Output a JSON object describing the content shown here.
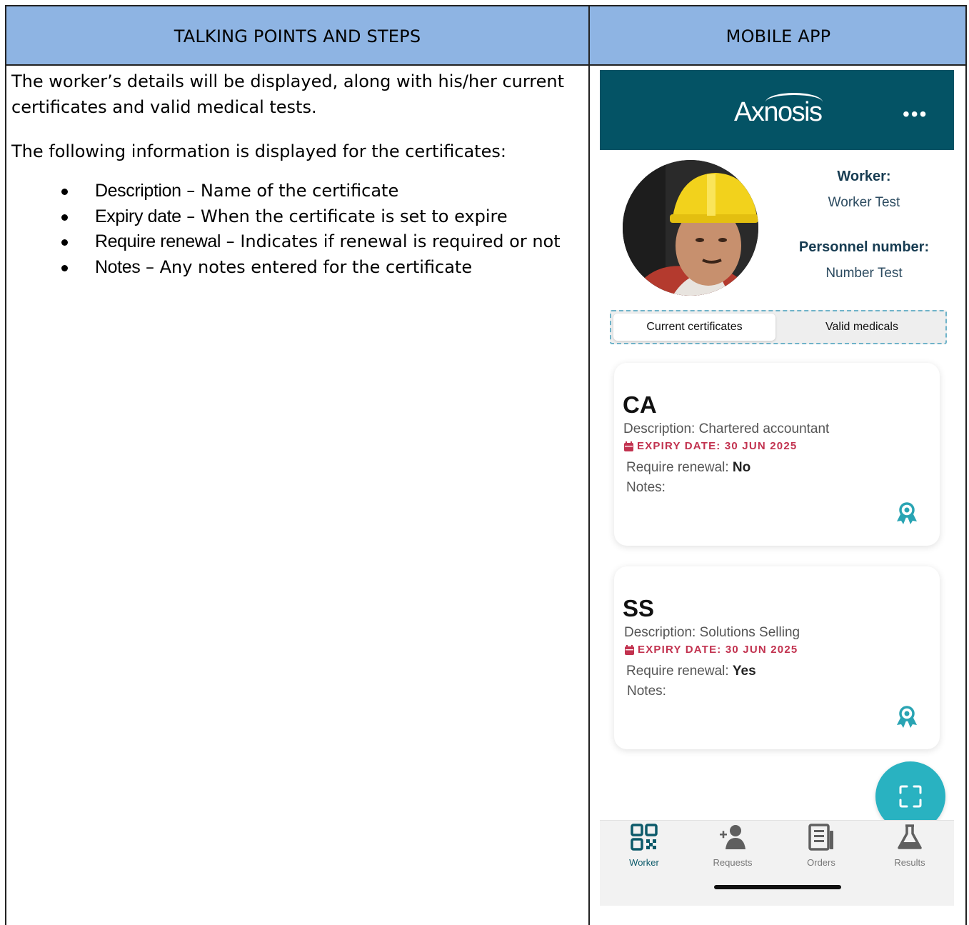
{
  "document": {
    "header_left": "TALKING POINTS AND STEPS",
    "header_right": "MOBILE APP",
    "paragraph1": "The worker’s details will be displayed, along with his/her current certificates and valid medical tests.",
    "paragraph2": "The following information is displayed for the certificates:",
    "bullets": [
      {
        "term": "Description",
        "dash": " – ",
        "text": "Name of the certificate"
      },
      {
        "term": "Expiry date",
        "dash": " – ",
        "text": "When the certificate is set to expire"
      },
      {
        "term": "Require renewal",
        "dash": " – ",
        "text": "Indicates if renewal is required or not"
      },
      {
        "term": "Notes",
        "dash": " – ",
        "text": "Any notes entered for the certificate"
      }
    ]
  },
  "app": {
    "logo_text": "Axnosis",
    "menu_icon": "more-dots-icon",
    "worker_label": "Worker:",
    "worker_value": "Worker Test",
    "personnel_label": "Personnel number:",
    "personnel_value": "Number Test",
    "tabs": [
      "Current certificates",
      "Valid medicals"
    ],
    "certificates": [
      {
        "code": "CA",
        "description": "Description: Chartered accountant",
        "expiry": "EXPIRY DATE: 30 JUN 2025",
        "renewal_label": "Require renewal: ",
        "renewal_value": "No",
        "notes": "Notes:"
      },
      {
        "code": "SS",
        "description": "Description: Solutions Selling",
        "expiry": "EXPIRY DATE: 30 JUN 2025",
        "renewal_label": "Require renewal: ",
        "renewal_value": "Yes",
        "notes": "Notes:"
      }
    ],
    "nav": [
      "Worker",
      "Requests",
      "Orders",
      "Results"
    ],
    "colors": {
      "header": "#045365",
      "accent": "#29b2c1",
      "expiry": "#c2324f",
      "doc_header": "#8eb4e3"
    }
  }
}
